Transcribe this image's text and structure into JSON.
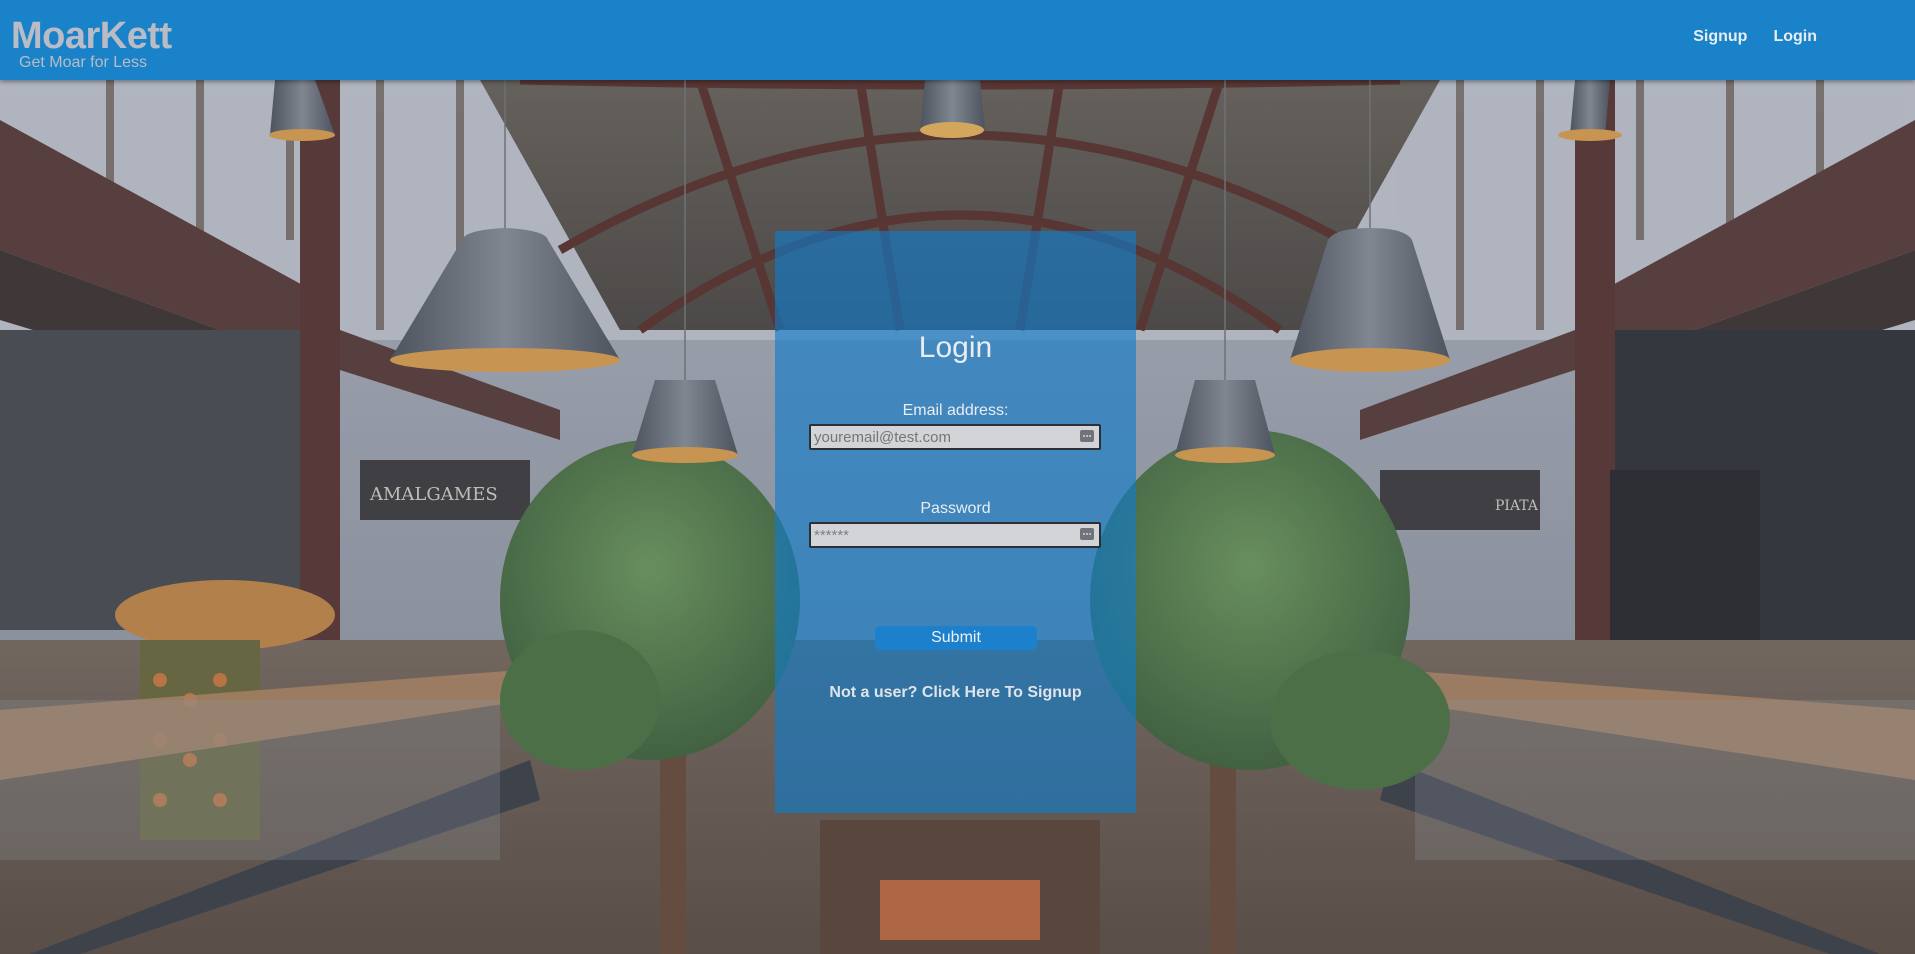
{
  "header": {
    "brand_name": "MoarKett",
    "brand_tagline": "Get Moar for Less",
    "nav": [
      {
        "label": "Signup"
      },
      {
        "label": "Login"
      }
    ]
  },
  "login": {
    "title": "Login",
    "email_label": "Email address:",
    "email_placeholder": "youremail@test.com",
    "password_label": "Password",
    "password_value": "******",
    "field_icon": "password-manager-icon",
    "submit_label": "Submit",
    "signup_link": "Not a user? Click Here To Signup"
  },
  "background": {
    "signs": [
      "AMALGAMES",
      "PIATA"
    ]
  },
  "colors": {
    "header": "#1a82c8",
    "panel": "#0e7dcd",
    "button": "#1c80cc"
  }
}
